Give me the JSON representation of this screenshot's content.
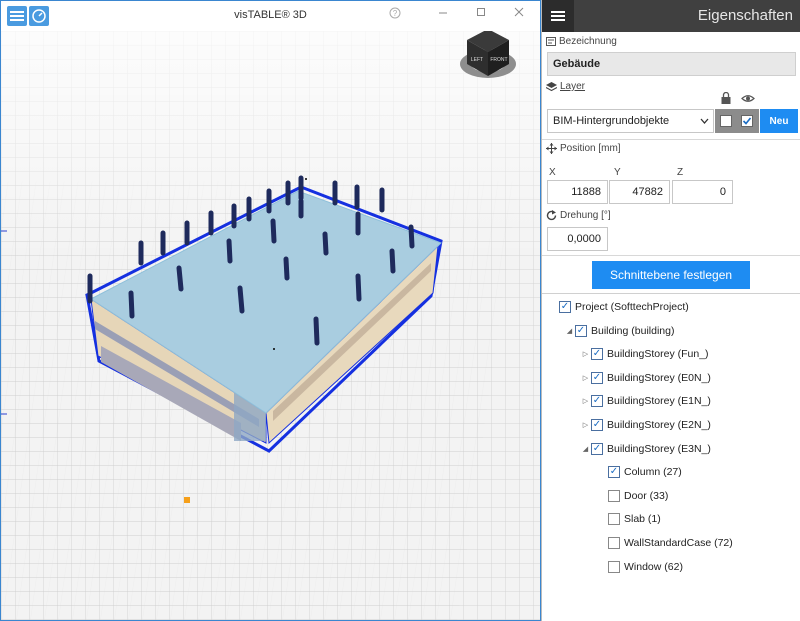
{
  "window": {
    "title": "visTABLE® 3D"
  },
  "viewcube": {
    "left_label": "LEFT",
    "front_label": "FRONT"
  },
  "panel": {
    "title": "Eigenschaften",
    "designation": {
      "label": "Bezeichnung",
      "value": "Gebäude"
    },
    "layer": {
      "label": "Layer",
      "value": "BIM-Hintergrundobjekte",
      "locked": false,
      "visible": true,
      "new_label": "Neu"
    },
    "position": {
      "label": "Position [mm]",
      "x_label": "X",
      "y_label": "Y",
      "z_label": "Z",
      "x": "11888",
      "y": "47882",
      "z": "0"
    },
    "rotation": {
      "label": "Drehung [°]",
      "value": "0,0000"
    },
    "apply_button": "Schnittebene festlegen",
    "tree": [
      {
        "label": "Project (SofttechProject)",
        "level": 0,
        "arrow": "",
        "checked": true
      },
      {
        "label": "Building (building)",
        "level": 1,
        "arrow": "expanded",
        "checked": true
      },
      {
        "label": "BuildingStorey (Fun_)",
        "level": 2,
        "arrow": "collapsed",
        "checked": true
      },
      {
        "label": "BuildingStorey (E0N_)",
        "level": 2,
        "arrow": "collapsed",
        "checked": true
      },
      {
        "label": "BuildingStorey (E1N_)",
        "level": 2,
        "arrow": "collapsed",
        "checked": true
      },
      {
        "label": "BuildingStorey (E2N_)",
        "level": 2,
        "arrow": "collapsed",
        "checked": true
      },
      {
        "label": "BuildingStorey (E3N_)",
        "level": 2,
        "arrow": "expanded",
        "checked": true
      },
      {
        "label": "Column (27)",
        "level": 3,
        "arrow": "",
        "checked": true
      },
      {
        "label": "Door (33)",
        "level": 3,
        "arrow": "",
        "checked": false
      },
      {
        "label": "Slab (1)",
        "level": 3,
        "arrow": "",
        "checked": false
      },
      {
        "label": "WallStandardCase (72)",
        "level": 3,
        "arrow": "",
        "checked": false
      },
      {
        "label": "Window (62)",
        "level": 3,
        "arrow": "",
        "checked": false
      }
    ]
  }
}
